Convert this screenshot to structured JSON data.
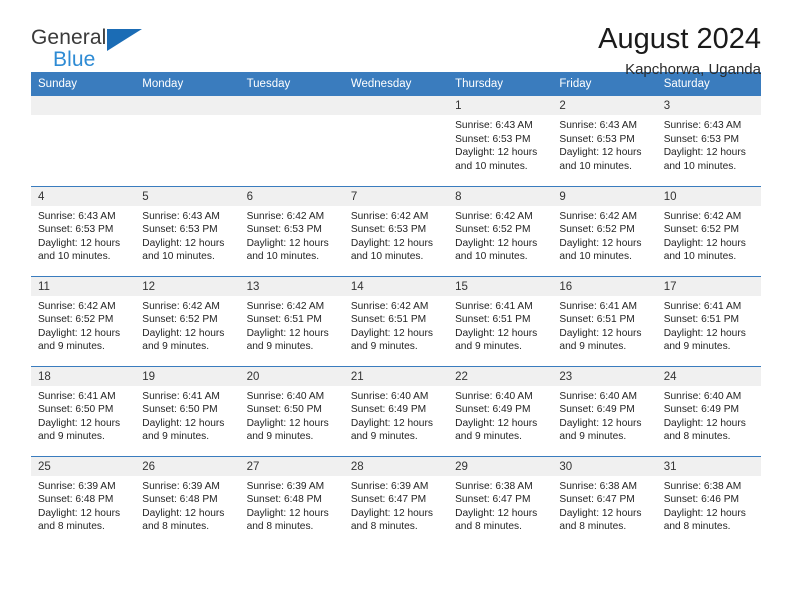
{
  "brand": {
    "line1": "General",
    "line2": "Blue",
    "triangle_color": "#1b6cb5",
    "blue_color": "#2e8bd4"
  },
  "header": {
    "title": "August 2024",
    "subtitle": "Kapchorwa, Uganda",
    "header_bg": "#3a7cbe",
    "daynum_bg": "#f0f0f0"
  },
  "weekdays": [
    "Sunday",
    "Monday",
    "Tuesday",
    "Wednesday",
    "Thursday",
    "Friday",
    "Saturday"
  ],
  "weeks": [
    [
      {
        "day": "",
        "sunrise": "",
        "sunset": "",
        "daylight1": "",
        "daylight2": ""
      },
      {
        "day": "",
        "sunrise": "",
        "sunset": "",
        "daylight1": "",
        "daylight2": ""
      },
      {
        "day": "",
        "sunrise": "",
        "sunset": "",
        "daylight1": "",
        "daylight2": ""
      },
      {
        "day": "",
        "sunrise": "",
        "sunset": "",
        "daylight1": "",
        "daylight2": ""
      },
      {
        "day": "1",
        "sunrise": "Sunrise: 6:43 AM",
        "sunset": "Sunset: 6:53 PM",
        "daylight1": "Daylight: 12 hours",
        "daylight2": "and 10 minutes."
      },
      {
        "day": "2",
        "sunrise": "Sunrise: 6:43 AM",
        "sunset": "Sunset: 6:53 PM",
        "daylight1": "Daylight: 12 hours",
        "daylight2": "and 10 minutes."
      },
      {
        "day": "3",
        "sunrise": "Sunrise: 6:43 AM",
        "sunset": "Sunset: 6:53 PM",
        "daylight1": "Daylight: 12 hours",
        "daylight2": "and 10 minutes."
      }
    ],
    [
      {
        "day": "4",
        "sunrise": "Sunrise: 6:43 AM",
        "sunset": "Sunset: 6:53 PM",
        "daylight1": "Daylight: 12 hours",
        "daylight2": "and 10 minutes."
      },
      {
        "day": "5",
        "sunrise": "Sunrise: 6:43 AM",
        "sunset": "Sunset: 6:53 PM",
        "daylight1": "Daylight: 12 hours",
        "daylight2": "and 10 minutes."
      },
      {
        "day": "6",
        "sunrise": "Sunrise: 6:42 AM",
        "sunset": "Sunset: 6:53 PM",
        "daylight1": "Daylight: 12 hours",
        "daylight2": "and 10 minutes."
      },
      {
        "day": "7",
        "sunrise": "Sunrise: 6:42 AM",
        "sunset": "Sunset: 6:53 PM",
        "daylight1": "Daylight: 12 hours",
        "daylight2": "and 10 minutes."
      },
      {
        "day": "8",
        "sunrise": "Sunrise: 6:42 AM",
        "sunset": "Sunset: 6:52 PM",
        "daylight1": "Daylight: 12 hours",
        "daylight2": "and 10 minutes."
      },
      {
        "day": "9",
        "sunrise": "Sunrise: 6:42 AM",
        "sunset": "Sunset: 6:52 PM",
        "daylight1": "Daylight: 12 hours",
        "daylight2": "and 10 minutes."
      },
      {
        "day": "10",
        "sunrise": "Sunrise: 6:42 AM",
        "sunset": "Sunset: 6:52 PM",
        "daylight1": "Daylight: 12 hours",
        "daylight2": "and 10 minutes."
      }
    ],
    [
      {
        "day": "11",
        "sunrise": "Sunrise: 6:42 AM",
        "sunset": "Sunset: 6:52 PM",
        "daylight1": "Daylight: 12 hours",
        "daylight2": "and 9 minutes."
      },
      {
        "day": "12",
        "sunrise": "Sunrise: 6:42 AM",
        "sunset": "Sunset: 6:52 PM",
        "daylight1": "Daylight: 12 hours",
        "daylight2": "and 9 minutes."
      },
      {
        "day": "13",
        "sunrise": "Sunrise: 6:42 AM",
        "sunset": "Sunset: 6:51 PM",
        "daylight1": "Daylight: 12 hours",
        "daylight2": "and 9 minutes."
      },
      {
        "day": "14",
        "sunrise": "Sunrise: 6:42 AM",
        "sunset": "Sunset: 6:51 PM",
        "daylight1": "Daylight: 12 hours",
        "daylight2": "and 9 minutes."
      },
      {
        "day": "15",
        "sunrise": "Sunrise: 6:41 AM",
        "sunset": "Sunset: 6:51 PM",
        "daylight1": "Daylight: 12 hours",
        "daylight2": "and 9 minutes."
      },
      {
        "day": "16",
        "sunrise": "Sunrise: 6:41 AM",
        "sunset": "Sunset: 6:51 PM",
        "daylight1": "Daylight: 12 hours",
        "daylight2": "and 9 minutes."
      },
      {
        "day": "17",
        "sunrise": "Sunrise: 6:41 AM",
        "sunset": "Sunset: 6:51 PM",
        "daylight1": "Daylight: 12 hours",
        "daylight2": "and 9 minutes."
      }
    ],
    [
      {
        "day": "18",
        "sunrise": "Sunrise: 6:41 AM",
        "sunset": "Sunset: 6:50 PM",
        "daylight1": "Daylight: 12 hours",
        "daylight2": "and 9 minutes."
      },
      {
        "day": "19",
        "sunrise": "Sunrise: 6:41 AM",
        "sunset": "Sunset: 6:50 PM",
        "daylight1": "Daylight: 12 hours",
        "daylight2": "and 9 minutes."
      },
      {
        "day": "20",
        "sunrise": "Sunrise: 6:40 AM",
        "sunset": "Sunset: 6:50 PM",
        "daylight1": "Daylight: 12 hours",
        "daylight2": "and 9 minutes."
      },
      {
        "day": "21",
        "sunrise": "Sunrise: 6:40 AM",
        "sunset": "Sunset: 6:49 PM",
        "daylight1": "Daylight: 12 hours",
        "daylight2": "and 9 minutes."
      },
      {
        "day": "22",
        "sunrise": "Sunrise: 6:40 AM",
        "sunset": "Sunset: 6:49 PM",
        "daylight1": "Daylight: 12 hours",
        "daylight2": "and 9 minutes."
      },
      {
        "day": "23",
        "sunrise": "Sunrise: 6:40 AM",
        "sunset": "Sunset: 6:49 PM",
        "daylight1": "Daylight: 12 hours",
        "daylight2": "and 9 minutes."
      },
      {
        "day": "24",
        "sunrise": "Sunrise: 6:40 AM",
        "sunset": "Sunset: 6:49 PM",
        "daylight1": "Daylight: 12 hours",
        "daylight2": "and 8 minutes."
      }
    ],
    [
      {
        "day": "25",
        "sunrise": "Sunrise: 6:39 AM",
        "sunset": "Sunset: 6:48 PM",
        "daylight1": "Daylight: 12 hours",
        "daylight2": "and 8 minutes."
      },
      {
        "day": "26",
        "sunrise": "Sunrise: 6:39 AM",
        "sunset": "Sunset: 6:48 PM",
        "daylight1": "Daylight: 12 hours",
        "daylight2": "and 8 minutes."
      },
      {
        "day": "27",
        "sunrise": "Sunrise: 6:39 AM",
        "sunset": "Sunset: 6:48 PM",
        "daylight1": "Daylight: 12 hours",
        "daylight2": "and 8 minutes."
      },
      {
        "day": "28",
        "sunrise": "Sunrise: 6:39 AM",
        "sunset": "Sunset: 6:47 PM",
        "daylight1": "Daylight: 12 hours",
        "daylight2": "and 8 minutes."
      },
      {
        "day": "29",
        "sunrise": "Sunrise: 6:38 AM",
        "sunset": "Sunset: 6:47 PM",
        "daylight1": "Daylight: 12 hours",
        "daylight2": "and 8 minutes."
      },
      {
        "day": "30",
        "sunrise": "Sunrise: 6:38 AM",
        "sunset": "Sunset: 6:47 PM",
        "daylight1": "Daylight: 12 hours",
        "daylight2": "and 8 minutes."
      },
      {
        "day": "31",
        "sunrise": "Sunrise: 6:38 AM",
        "sunset": "Sunset: 6:46 PM",
        "daylight1": "Daylight: 12 hours",
        "daylight2": "and 8 minutes."
      }
    ]
  ]
}
